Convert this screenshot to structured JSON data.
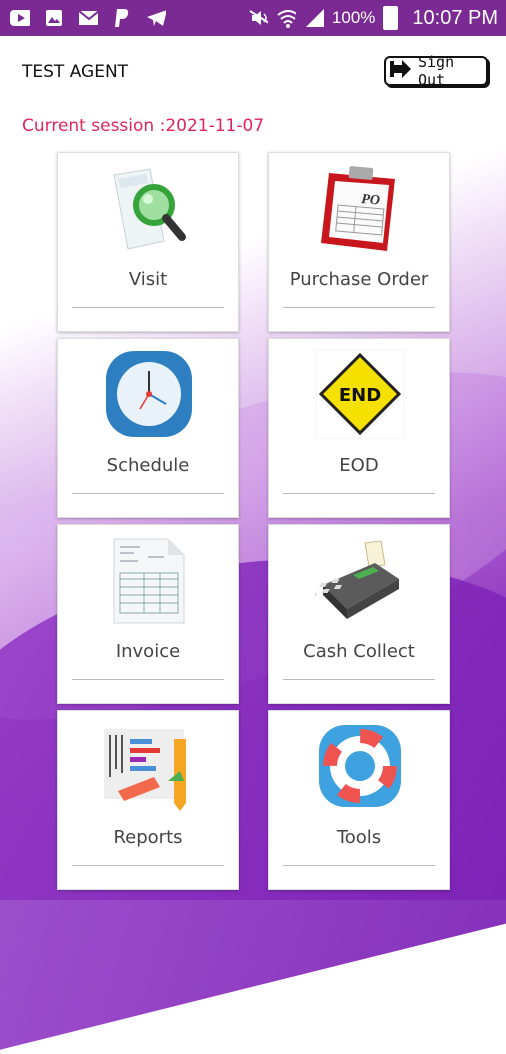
{
  "status_bar": {
    "battery": "100%",
    "time": "10:07 PM",
    "left_icons": [
      "youtube-icon",
      "gallery-icon",
      "mail-icon",
      "paypal-icon",
      "telegram-icon"
    ],
    "right_icons": [
      "mute-icon",
      "wifi-icon",
      "signal-icon",
      "battery-icon"
    ]
  },
  "header": {
    "agent_name": "TEST AGENT",
    "signout_label": "Sign Out",
    "session_text": "Current session :2021-11-07"
  },
  "tiles": [
    {
      "label": "Visit",
      "icon": "visit-magnifier-icon"
    },
    {
      "label": "Purchase Order",
      "icon": "purchase-order-clipboard-icon"
    },
    {
      "label": "Schedule",
      "icon": "clock-icon"
    },
    {
      "label": "EOD",
      "icon": "end-sign-icon"
    },
    {
      "label": "Invoice",
      "icon": "invoice-document-icon"
    },
    {
      "label": "Cash Collect",
      "icon": "card-terminal-icon"
    },
    {
      "label": "Reports",
      "icon": "reports-chart-icon"
    },
    {
      "label": "Tools",
      "icon": "lifebuoy-icon"
    }
  ],
  "colors": {
    "status_bar": "#7a2a92",
    "session_text": "#e0245e",
    "background_purple": "#8c37be"
  }
}
